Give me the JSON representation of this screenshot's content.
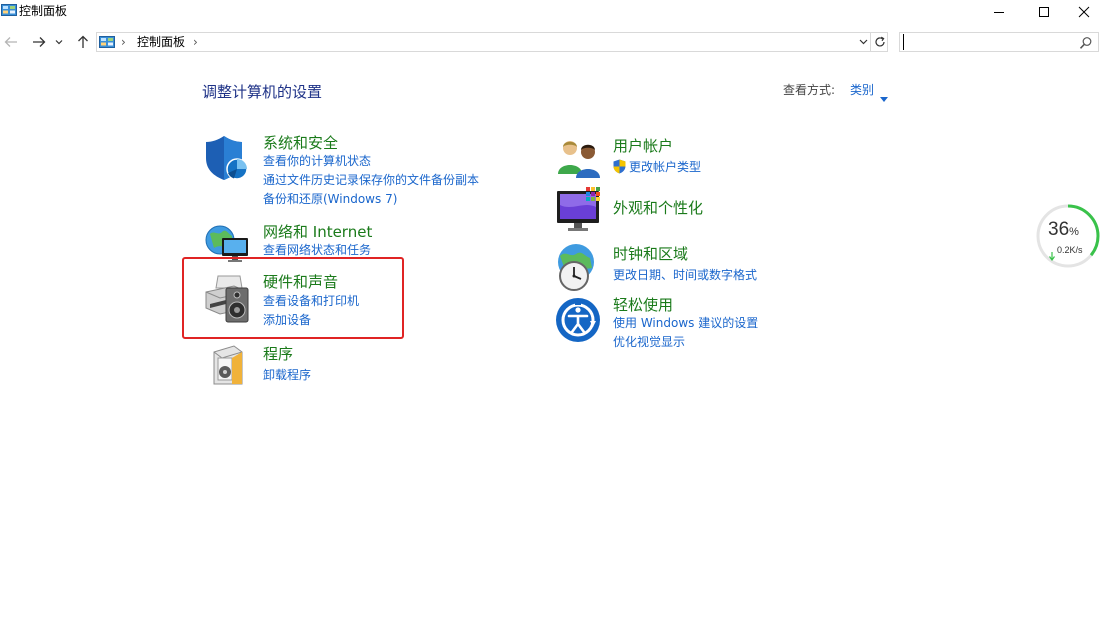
{
  "window": {
    "title": "控制面板"
  },
  "address": {
    "crumb": "控制面板",
    "separator": "›"
  },
  "search": {
    "placeholder": ""
  },
  "content": {
    "heading": "调整计算机的设置",
    "view_by_label": "查看方式:",
    "view_by_value": "类别"
  },
  "categories": {
    "system": {
      "title": "系统和安全",
      "links": [
        "查看你的计算机状态",
        "通过文件历史记录保存你的文件备份副本",
        "备份和还原(Windows 7)"
      ]
    },
    "network": {
      "title": "网络和 Internet",
      "links": [
        "查看网络状态和任务"
      ]
    },
    "hardware": {
      "title": "硬件和声音",
      "links": [
        "查看设备和打印机",
        "添加设备"
      ]
    },
    "programs": {
      "title": "程序",
      "links": [
        "卸载程序"
      ]
    },
    "user": {
      "title": "用户帐户",
      "links": [
        "更改帐户类型"
      ]
    },
    "appearance": {
      "title": "外观和个性化",
      "links": []
    },
    "clock": {
      "title": "时钟和区域",
      "links": [
        "更改日期、时间或数字格式"
      ]
    },
    "ease": {
      "title": "轻松使用",
      "links": [
        "使用 Windows 建议的设置",
        "优化视觉显示"
      ]
    }
  },
  "speed_widget": {
    "percent": "36",
    "percent_unit": "%",
    "rate": "0.2K/s",
    "progress": 0.36
  }
}
